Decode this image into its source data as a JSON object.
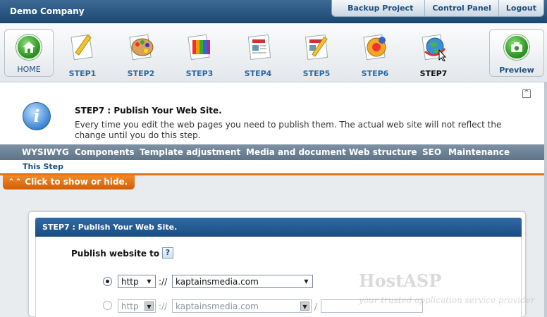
{
  "header": {
    "company": "Demo Company",
    "links": [
      "Backup Project",
      "Control Panel",
      "Logout"
    ]
  },
  "nav": {
    "home_label": "HOME",
    "preview_label": "Preview",
    "steps": [
      "STEP1",
      "STEP2",
      "STEP3",
      "STEP4",
      "STEP5",
      "STEP6",
      "STEP7"
    ],
    "active_step": "STEP7"
  },
  "info": {
    "title": "STEP7 : Publish Your Web Site.",
    "description": "Every time you edit the web pages you need to publish them. The actual web site will not reflect the change until you do this step."
  },
  "tabs": [
    "WYSIWYG",
    "Components",
    "Template adjustment",
    "Media and document",
    "Web structure",
    "SEO",
    "Maintenance"
  ],
  "subtab": "This Step",
  "toggle_label": "Click to show or hide.",
  "panel": {
    "title": "STEP7 : Publish Your Web Site.",
    "publish_label": "Publish website to :",
    "help": "?",
    "rows": [
      {
        "selected": true,
        "protocol": "http",
        "sep": "://",
        "domain": "kaptainsmedia.com"
      },
      {
        "selected": false,
        "protocol": "http",
        "sep": "://",
        "domain": "kaptainsmedia.com",
        "slash": "/",
        "path": ""
      }
    ]
  },
  "watermark": {
    "brand": "HostASP",
    "tagline": "your trusted application service provider"
  }
}
